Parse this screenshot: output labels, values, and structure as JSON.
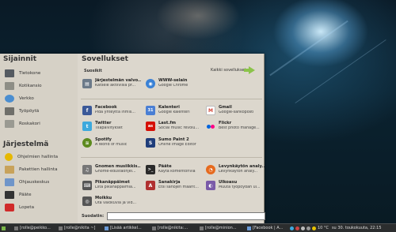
{
  "places": {
    "title": "Sijainnit",
    "items": [
      {
        "label": "Tietokone",
        "color": "#555b61"
      },
      {
        "label": "Kotikansio",
        "color": "#8e8e86"
      },
      {
        "label": "Verkko",
        "color": "#4b8ed0"
      },
      {
        "label": "Työpöytä",
        "color": "#6f6f6a"
      },
      {
        "label": "Roskakori",
        "color": "#9a9a92"
      }
    ]
  },
  "system": {
    "title": "Järjestelmä",
    "items": [
      {
        "label": "Ohjelmien hallinta",
        "color": "#e6b800"
      },
      {
        "label": "Pakettien hallinta",
        "color": "#c8a25a"
      },
      {
        "label": "Ohjauskeskus",
        "color": "#6f95c9"
      },
      {
        "label": "Pääte",
        "color": "#333333"
      },
      {
        "label": "Lopeta",
        "color": "#d02a2a"
      }
    ]
  },
  "apps": {
    "title": "Sovellukset",
    "favorites_label": "Suosikit",
    "all_apps_label": "Kaikki sovellukset",
    "filter_label": "Suodatin:",
    "items": [
      {
        "name": "Järjestelmän valvo...",
        "desc": "Katsele aktiivisia pr...",
        "icon": "system-monitor-icon",
        "color": "#6c7a89",
        "glyph": "▤"
      },
      {
        "name": "WWW-selain",
        "desc": "Google Chrome",
        "icon": "chrome-icon",
        "color": "#3b82d6",
        "glyph": "◉"
      },
      {
        "name": "Facebook",
        "desc": "Pidä yhteyttä ihmis...",
        "icon": "facebook-icon",
        "color": "#3b5998",
        "glyph": "f"
      },
      {
        "name": "Kalenteri",
        "desc": "Google kalenteri",
        "icon": "calendar-icon",
        "color": "#4a7fd4",
        "glyph": "31"
      },
      {
        "name": "Gmail",
        "desc": "Google-sähköposti",
        "icon": "gmail-icon",
        "color": "#d44638",
        "glyph": "M"
      },
      {
        "name": "Twitter",
        "desc": "Tilapäivitykset",
        "icon": "twitter-icon",
        "color": "#3ea9dd",
        "glyph": "t"
      },
      {
        "name": "Last.fm",
        "desc": "Social music revolu...",
        "icon": "lastfm-icon",
        "color": "#d51007",
        "glyph": "as"
      },
      {
        "name": "Flickr",
        "desc": "Best photo manage...",
        "icon": "flickr-icon",
        "color": "#ffffff",
        "glyph": "●"
      },
      {
        "name": "Spotify",
        "desc": "A World of music",
        "icon": "spotify-icon",
        "color": "#5c8a1e",
        "glyph": "≋"
      },
      {
        "name": "Sumo Paint 2",
        "desc": "Online Image Editor",
        "icon": "sumo-paint-icon",
        "color": "#1f3d7a",
        "glyph": "S"
      },
      {
        "name": "Gnomen musiikkis...",
        "desc": "Gnome-edustaohjel...",
        "icon": "music-player-icon",
        "color": "#777777",
        "glyph": "♫"
      },
      {
        "name": "Pääte",
        "desc": "Käytä komentoriviä",
        "icon": "terminal-icon",
        "color": "#2a2a2a",
        "glyph": ">_"
      },
      {
        "name": "Levynkäytön analy...",
        "desc": "Levynkäytön analy...",
        "icon": "disk-usage-icon",
        "color": "#e66a1e",
        "glyph": "◔"
      },
      {
        "name": "Pikanäppäimet",
        "desc": "Liitä pikanäppäimiä...",
        "icon": "keyboard-icon",
        "color": "#555555",
        "glyph": "⌨"
      },
      {
        "name": "Sanakirja",
        "desc": "Etsi sanojen määrit...",
        "icon": "dictionary-icon",
        "color": "#b03030",
        "glyph": "A"
      },
      {
        "name": "Ulkoasu",
        "desc": "Muuta työpöydän ul...",
        "icon": "appearance-icon",
        "color": "#7a5aa8",
        "glyph": "◐"
      },
      {
        "name": "Moikku",
        "desc": "Ota valokuvia ja vid...",
        "icon": "camera-icon",
        "color": "#555555",
        "glyph": "◎"
      }
    ]
  },
  "taskbar": {
    "windows": [
      "[rolle@peikko...",
      "[rolle@nikita ~]",
      "[Lisää artikkel...",
      "[rolle@nikita:...",
      "[rolle@minion...",
      "[Facebook | A..."
    ],
    "temperature": "10 °C",
    "clock": "su 30. toukokuuta, 22:15"
  }
}
